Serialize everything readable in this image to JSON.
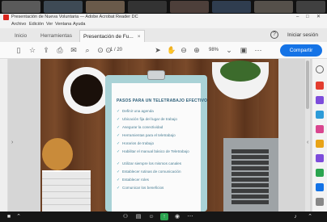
{
  "window": {
    "title": "Presentación de Nueva Voluntaria — Adobe Acrobat Reader DC",
    "controls": [
      "–",
      "□",
      "✕"
    ]
  },
  "menu": [
    "Archivo",
    "Edición",
    "Ver",
    "Ventana",
    "Ayuda"
  ],
  "tabs": {
    "items": [
      {
        "label": "Inicio"
      },
      {
        "label": "Herramientas"
      },
      {
        "label": "Presentación de Fu...",
        "active": true
      }
    ],
    "close_glyph": "×",
    "help_glyph": "?",
    "sign_in": "Iniciar sesión"
  },
  "toolbar": {
    "page": "1",
    "total_pages": "/ 20",
    "zoom": "98%",
    "share": "Compartir"
  },
  "document": {
    "title": "PASOS PARA UN TELETRABAJO EFECTIVO",
    "items": [
      "Definir una agenda",
      "Ubicación fija del lugar de trabajo",
      "Asegurar la conectividad",
      "Herramientas para el teletrabajo",
      "Horarios de trabajo",
      "Habilitar el manual básico de Teletrabajo",
      "Utilizar siempre los mismos canales",
      "Establecer rutinas de comunicación",
      "Establecer roles",
      "Comunicar los beneficios"
    ]
  },
  "colors": {
    "share_button": "#1473e6",
    "clipboard": "#a9d2d6",
    "checklist_text": "#4a7e94",
    "app_icon": "#d9251d"
  }
}
